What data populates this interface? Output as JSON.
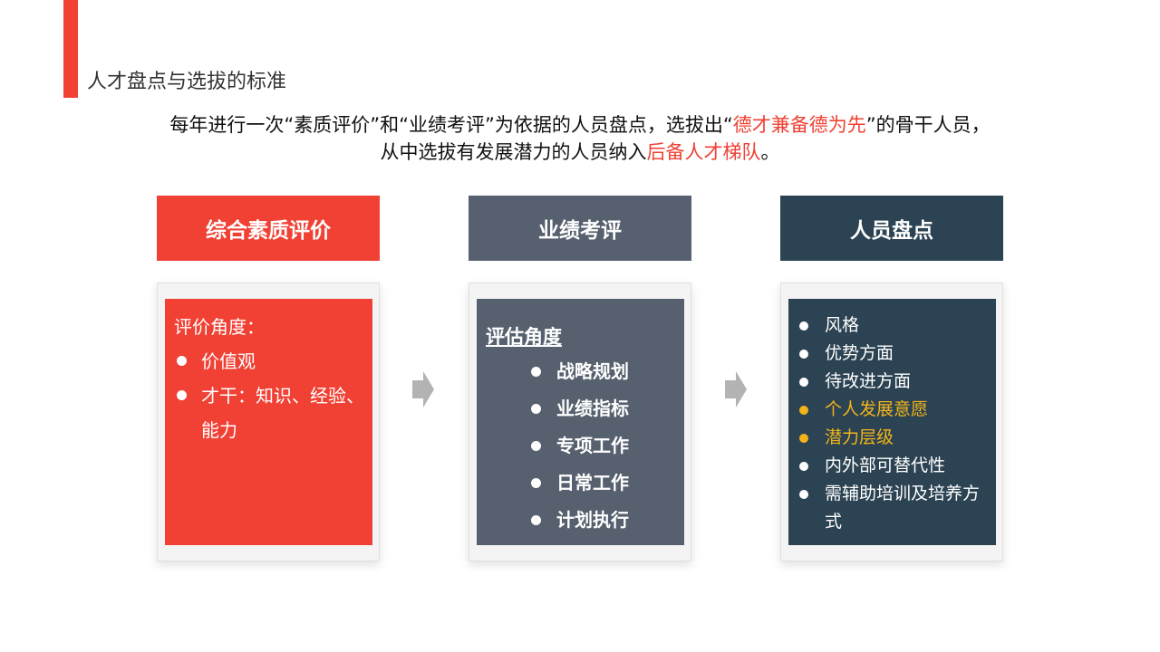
{
  "page": {
    "title": "人才盘点与选拔的标准"
  },
  "intro": {
    "line1": {
      "prefix": "每年进行一次“素质评价”和“业绩考评”为依据的人员盘点，选拔出“",
      "highlight": "德才兼备德为先",
      "suffix": "”的骨干人员，"
    },
    "line2": {
      "prefix": "从中选拔有发展潜力的人员纳入",
      "highlight": "后备人才梯队",
      "suffix": "。"
    }
  },
  "columns": [
    {
      "header": "综合素质评价",
      "heading": "评价角度：",
      "items": [
        "价值观",
        "才干：知识、经验、能力"
      ]
    },
    {
      "header": "业绩考评",
      "heading": "评估角度",
      "items": [
        "战略规划",
        "业绩指标",
        "专项工作",
        "日常工作",
        "计划执行"
      ]
    },
    {
      "header": "人员盘点",
      "items": [
        "风格",
        "优势方面",
        "待改进方面",
        "个人发展意愿",
        "潜力层级",
        "内外部可替代性",
        "需辅助培训及培养方式"
      ]
    }
  ],
  "icons": {
    "arrow": "right-arrow-icon"
  },
  "colors": {
    "accent": "#f04134",
    "slate": "#56606e",
    "dark": "#2c4353",
    "gold": "#f2b418"
  }
}
